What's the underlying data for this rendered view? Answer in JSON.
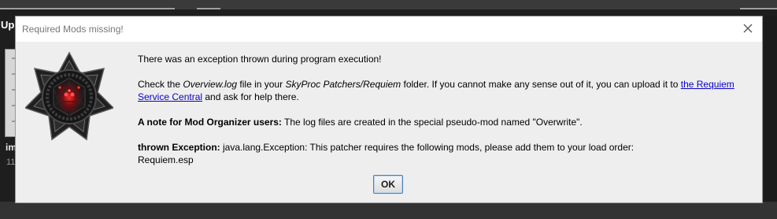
{
  "background": {
    "partial_label_top": "Up",
    "partial_label_mid": "im",
    "partial_number": "11"
  },
  "dialog": {
    "title": "Required Mods missing!",
    "close_icon": "close-icon",
    "logo_icon": "dark-star-dice-logo",
    "line1": "There was an exception thrown during program execution!",
    "line2": {
      "t1": "Check the ",
      "i1": "Overview.log",
      "t2": " file in your ",
      "i2": "SkyProc Patchers/Requiem",
      "t3": " folder. If you cannot make any sense out of it, you can upload it to ",
      "link1": "the Requiem",
      "link2": "Service Central",
      "t4": " and ask for help there."
    },
    "note": {
      "bold": "A note for Mod Organizer users:",
      "text": " The log files are created in the special pseudo-mod named \"Overwrite\"."
    },
    "exception": {
      "bold": "thrown Exception:",
      "text": " java.lang.Exception: This patcher requires the following mods, please add them to your load order:",
      "mods": "Requiem.esp"
    },
    "ok_label": "OK"
  },
  "colors": {
    "link": "#0b00c8",
    "dialog_bg": "#eeeeee",
    "titlebar_bg": "#ffffff",
    "logo_accent": "#e0202a"
  }
}
